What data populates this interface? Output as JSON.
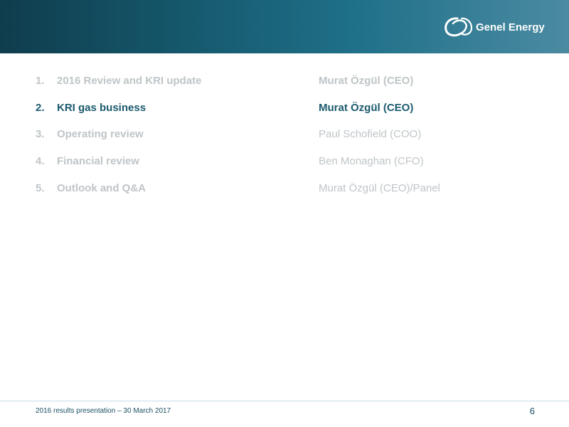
{
  "header": {
    "brand_name": "Genel Energy",
    "logo_icon": "genel-swirl-logo-icon",
    "band_colors": [
      "#0f3d4d",
      "#1f7089",
      "#4b8ba2"
    ]
  },
  "agenda": {
    "items": [
      {
        "number": "1.",
        "topic": "2016 Review and KRI update",
        "presenter": "Murat Özgül (CEO)",
        "active": false
      },
      {
        "number": "2.",
        "topic": "KRI gas business",
        "presenter": "Murat Özgül (CEO)",
        "active": true
      },
      {
        "number": "3.",
        "topic": "Operating review",
        "presenter": "Paul Schofield (COO)",
        "active": false
      },
      {
        "number": "4.",
        "topic": "Financial review",
        "presenter": "Ben Monaghan (CFO)",
        "active": false
      },
      {
        "number": "5.",
        "topic": "Outlook and Q&A",
        "presenter": "Murat Özgül (CEO)/Panel",
        "active": false
      }
    ],
    "active_color": "#1b5a6e",
    "inactive_color": "#bfc5c8"
  },
  "footer": {
    "text": "2016 results presentation – 30 March 2017",
    "page_number": "6"
  }
}
